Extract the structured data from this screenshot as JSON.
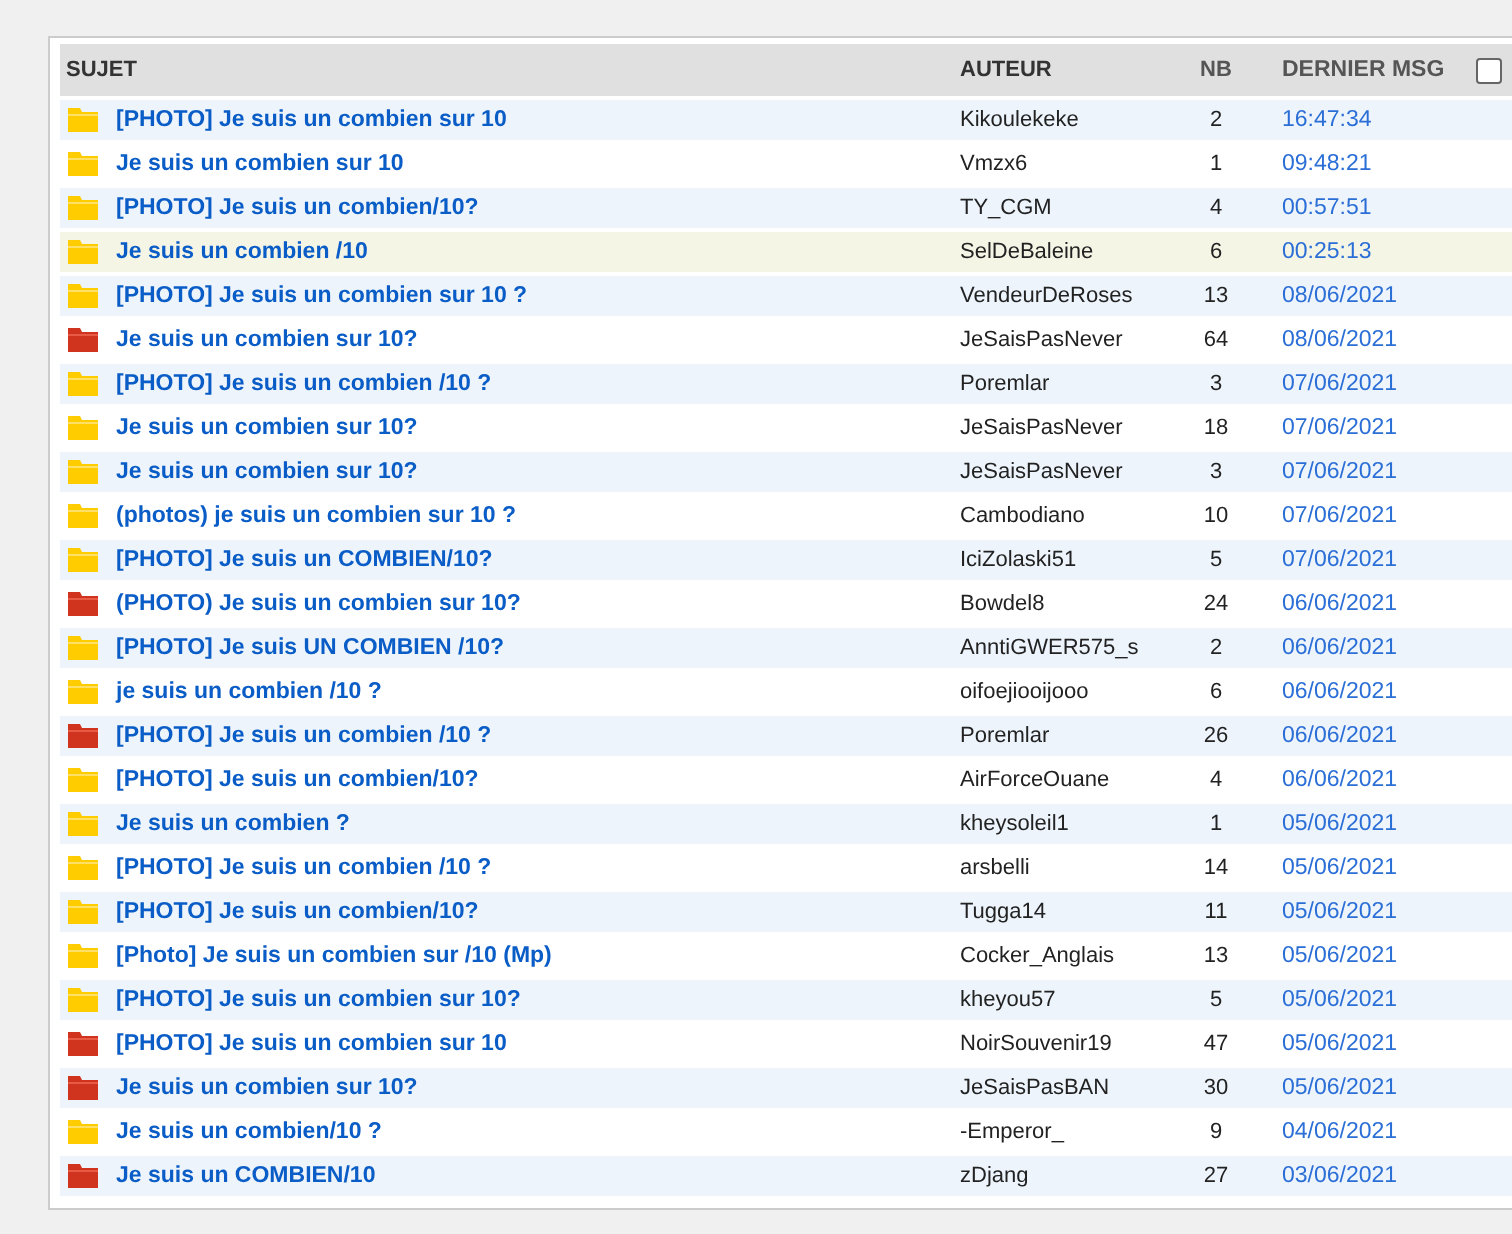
{
  "table": {
    "columns": [
      "SUJET",
      "AUTEUR",
      "NB",
      "DERNIER MSG"
    ],
    "select_all": {
      "checked": false
    },
    "rows": [
      {
        "subject": "[PHOTO] Je suis un combien sur 10",
        "author": "Kikoulekeke",
        "count": "2",
        "last": "16:47:34",
        "hot": false,
        "highlighted": false
      },
      {
        "subject": "Je suis un combien sur 10",
        "author": "Vmzx6",
        "count": "1",
        "last": "09:48:21",
        "hot": false,
        "highlighted": false
      },
      {
        "subject": "[PHOTO] Je suis un combien/10?",
        "author": "TY_CGM",
        "count": "4",
        "last": "00:57:51",
        "hot": false,
        "highlighted": false
      },
      {
        "subject": "Je suis un combien /10",
        "author": "SelDeBaleine",
        "count": "6",
        "last": "00:25:13",
        "hot": false,
        "highlighted": true
      },
      {
        "subject": "[PHOTO] Je suis un combien sur 10 ?",
        "author": "VendeurDeRoses",
        "count": "13",
        "last": "08/06/2021",
        "hot": false,
        "highlighted": false
      },
      {
        "subject": "Je suis un combien sur 10?",
        "author": "JeSaisPasNever",
        "count": "64",
        "last": "08/06/2021",
        "hot": true,
        "highlighted": false
      },
      {
        "subject": "[PHOTO] Je suis un combien /10 ?",
        "author": "Poremlar",
        "count": "3",
        "last": "07/06/2021",
        "hot": false,
        "highlighted": false
      },
      {
        "subject": "Je suis un combien sur 10?",
        "author": "JeSaisPasNever",
        "count": "18",
        "last": "07/06/2021",
        "hot": false,
        "highlighted": false
      },
      {
        "subject": "Je suis un combien sur 10?",
        "author": "JeSaisPasNever",
        "count": "3",
        "last": "07/06/2021",
        "hot": false,
        "highlighted": false
      },
      {
        "subject": "(photos) je suis un combien sur 10 ?",
        "author": "Cambodiano",
        "count": "10",
        "last": "07/06/2021",
        "hot": false,
        "highlighted": false
      },
      {
        "subject": "[PHOTO] Je suis un COMBIEN/10?",
        "author": "IciZolaski51",
        "count": "5",
        "last": "07/06/2021",
        "hot": false,
        "highlighted": false
      },
      {
        "subject": "(PHOTO) Je suis un combien sur 10?",
        "author": "Bowdel8",
        "count": "24",
        "last": "06/06/2021",
        "hot": true,
        "highlighted": false
      },
      {
        "subject": "[PHOTO] Je suis UN COMBIEN /10?",
        "author": "AnntiGWER575_s",
        "count": "2",
        "last": "06/06/2021",
        "hot": false,
        "highlighted": false
      },
      {
        "subject": "je suis un combien /10 ?",
        "author": "oifoejiooijooo",
        "count": "6",
        "last": "06/06/2021",
        "hot": false,
        "highlighted": false
      },
      {
        "subject": "[PHOTO] Je suis un combien /10 ?",
        "author": "Poremlar",
        "count": "26",
        "last": "06/06/2021",
        "hot": true,
        "highlighted": false
      },
      {
        "subject": "[PHOTO] Je suis un combien/10?",
        "author": "AirForceOuane",
        "count": "4",
        "last": "06/06/2021",
        "hot": false,
        "highlighted": false
      },
      {
        "subject": "Je suis un combien ?",
        "author": "kheysoleil1",
        "count": "1",
        "last": "05/06/2021",
        "hot": false,
        "highlighted": false
      },
      {
        "subject": "[PHOTO] Je suis un combien /10 ?",
        "author": "arsbelli",
        "count": "14",
        "last": "05/06/2021",
        "hot": false,
        "highlighted": false
      },
      {
        "subject": "[PHOTO] Je suis un combien/10?",
        "author": "Tugga14",
        "count": "11",
        "last": "05/06/2021",
        "hot": false,
        "highlighted": false
      },
      {
        "subject": "[Photo] Je suis un combien sur /10 (Mp)",
        "author": "Cocker_Anglais",
        "count": "13",
        "last": "05/06/2021",
        "hot": false,
        "highlighted": false
      },
      {
        "subject": "[PHOTO] Je suis un combien sur 10?",
        "author": "kheyou57",
        "count": "5",
        "last": "05/06/2021",
        "hot": false,
        "highlighted": false
      },
      {
        "subject": "[PHOTO] Je suis un combien sur 10",
        "author": "NoirSouvenir19",
        "count": "47",
        "last": "05/06/2021",
        "hot": true,
        "highlighted": false
      },
      {
        "subject": "Je suis un combien sur 10?",
        "author": "JeSaisPasBAN",
        "count": "30",
        "last": "05/06/2021",
        "hot": true,
        "highlighted": false
      },
      {
        "subject": "Je suis un combien/10 ?",
        "author": "-Emperor_",
        "count": "9",
        "last": "04/06/2021",
        "hot": false,
        "highlighted": false
      },
      {
        "subject": "Je suis un COMBIEN/10",
        "author": "zDjang",
        "count": "27",
        "last": "03/06/2021",
        "hot": true,
        "highlighted": false
      }
    ]
  }
}
